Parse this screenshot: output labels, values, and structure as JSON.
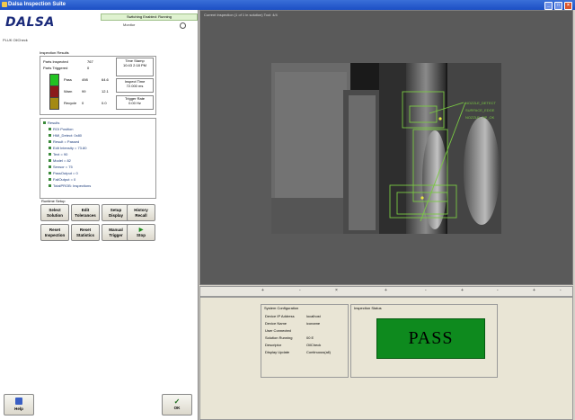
{
  "window": {
    "title": "Dalsa Inspection Suite",
    "controls": [
      "_",
      "□",
      "×"
    ]
  },
  "left_panel": {
    "logo": "DALSA",
    "hostname": "PLUK OilCheck",
    "status_text": "Switching Enabled: Running",
    "mode_text": "Monitor",
    "inspection_results": {
      "label": "Inspection Results",
      "parts_inspected_label": "Parts Inspected",
      "parts_inspected_value": "767",
      "parts_triggered_label": "Parts Triggered",
      "parts_triggered_value": "0",
      "pass_label": "Pass",
      "pass_count": "498",
      "pass_pct": "64.6",
      "warn_label": "Warn",
      "warn_count": "99",
      "warn_pct": "12.1",
      "recycle_label": "Recycle",
      "recycle_count": "0",
      "recycle_pct": "0.0",
      "time_stamp_label": "Time Stamp",
      "time_stamp_value": "10:43 2:18 PM",
      "inspect_time_label": "Inspect Time",
      "inspect_time_value": "72.000 ms",
      "trigger_rate_label": "Trigger Rate",
      "trigger_rate_value": "0.00 Hz",
      "colors": {
        "pass": "#22c322",
        "warn": "#8b1a1a",
        "recycle": "#a48a12"
      }
    },
    "tree_items": [
      {
        "label": "Results",
        "indent": 0
      },
      {
        "label": "ROI Position",
        "indent": 1
      },
      {
        "label": "HMI_Detect: 0x80",
        "indent": 1
      },
      {
        "label": "Result = Passed",
        "indent": 1
      },
      {
        "label": "Edit Intensity = 73.80",
        "indent": 1
      },
      {
        "label": "Text = 90",
        "indent": 1
      },
      {
        "label": "Model = 82",
        "indent": 1
      },
      {
        "label": "Sensor = 75",
        "indent": 1
      },
      {
        "label": "PassOutput = 0",
        "indent": 1
      },
      {
        "label": "FailOutput = 0",
        "indent": 1
      },
      {
        "label": "TotalPROB: Inspections",
        "indent": 1
      }
    ],
    "runtime_label": "Runtime Setup",
    "buttons": [
      {
        "line1": "Select",
        "line2": "Solution"
      },
      {
        "line1": "Edit",
        "line2": "Tolerances"
      },
      {
        "line1": "Setup",
        "line2": "Display"
      },
      {
        "line1": "History",
        "line2": "Recall"
      },
      {
        "line1": "Reset",
        "line2": "Inspection"
      },
      {
        "line1": "Reset",
        "line2": "Statistics"
      },
      {
        "line1": "Manual",
        "line2": "Trigger"
      },
      {
        "line1": "▶",
        "line2": "Stop"
      }
    ],
    "help_label": "Help",
    "ok_label": "OK"
  },
  "image_panel": {
    "header": "Current Inspection (1 of 1 in solution) Tool: 4/4",
    "annotations": [
      "NOZZLE_DETECT",
      "SURFACE_EDGE",
      "NOZZLE_TIP_OK"
    ],
    "overlay_color": "#7ac943"
  },
  "ruler": {
    "marks": [
      "+",
      "-",
      "×",
      "+",
      "-",
      "+",
      "-",
      "+",
      "-"
    ]
  },
  "system_config": {
    "label": "System Configuration",
    "fields": [
      {
        "k": "Device IP Address",
        "v": "localhost"
      },
      {
        "k": "Device Name",
        "v": "iconame"
      },
      {
        "k": "User Connected",
        "v": ""
      },
      {
        "k": "Solution Running",
        "v": "00 E"
      },
      {
        "k": "Descriptor",
        "v": "OilCheck"
      },
      {
        "k": "Display Update",
        "v": "Continuous(all)"
      }
    ]
  },
  "inspection_status": {
    "label": "Inspection Status",
    "value": "PASS",
    "color": "#0e8a1e"
  }
}
